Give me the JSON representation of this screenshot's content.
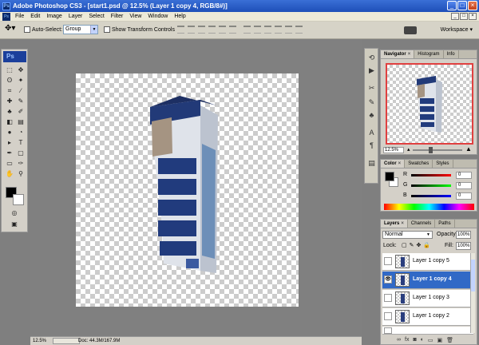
{
  "window": {
    "title": "Adobe Photoshop CS3 - [start1.psd @ 12.5% (Layer 1 copy 4, RGB/8#)]"
  },
  "menu": [
    "File",
    "Edit",
    "Image",
    "Layer",
    "Select",
    "Filter",
    "View",
    "Window",
    "Help"
  ],
  "options": {
    "auto_select_label": "Auto-Select:",
    "auto_select_value": "Group",
    "show_transform_label": "Show Transform Controls",
    "workspace_label": "Workspace ▾"
  },
  "toolbox": {
    "logo": "Ps"
  },
  "status": {
    "zoom": "12.5%",
    "doc": "Doc: 44.3M/167.9M"
  },
  "navigator": {
    "tabs": [
      "Navigator",
      "Histogram",
      "Info"
    ],
    "zoom": "12.5%"
  },
  "color_panel": {
    "tabs": [
      "Color",
      "Swatches",
      "Styles"
    ],
    "r_label": "R",
    "g_label": "G",
    "b_label": "B",
    "r_value": "0",
    "g_value": "0",
    "b_value": "0"
  },
  "layers_panel": {
    "tabs": [
      "Layers",
      "Channels",
      "Paths"
    ],
    "blend_mode": "Normal",
    "opacity_label": "Opacity:",
    "opacity_value": "100%",
    "lock_label": "Lock:",
    "fill_label": "Fill:",
    "fill_value": "100%",
    "layers": [
      {
        "name": "Layer 1 copy 5",
        "selected": false
      },
      {
        "name": "Layer 1 copy 4",
        "selected": true
      },
      {
        "name": "Layer 1 copy 3",
        "selected": false
      },
      {
        "name": "Layer 1 copy 2",
        "selected": false
      }
    ]
  },
  "colors": {
    "title_bar": "#1d4fb8",
    "selection": "#3169c6",
    "building_blue": "#2a3e7e",
    "navigator_frame": "#e04040"
  }
}
